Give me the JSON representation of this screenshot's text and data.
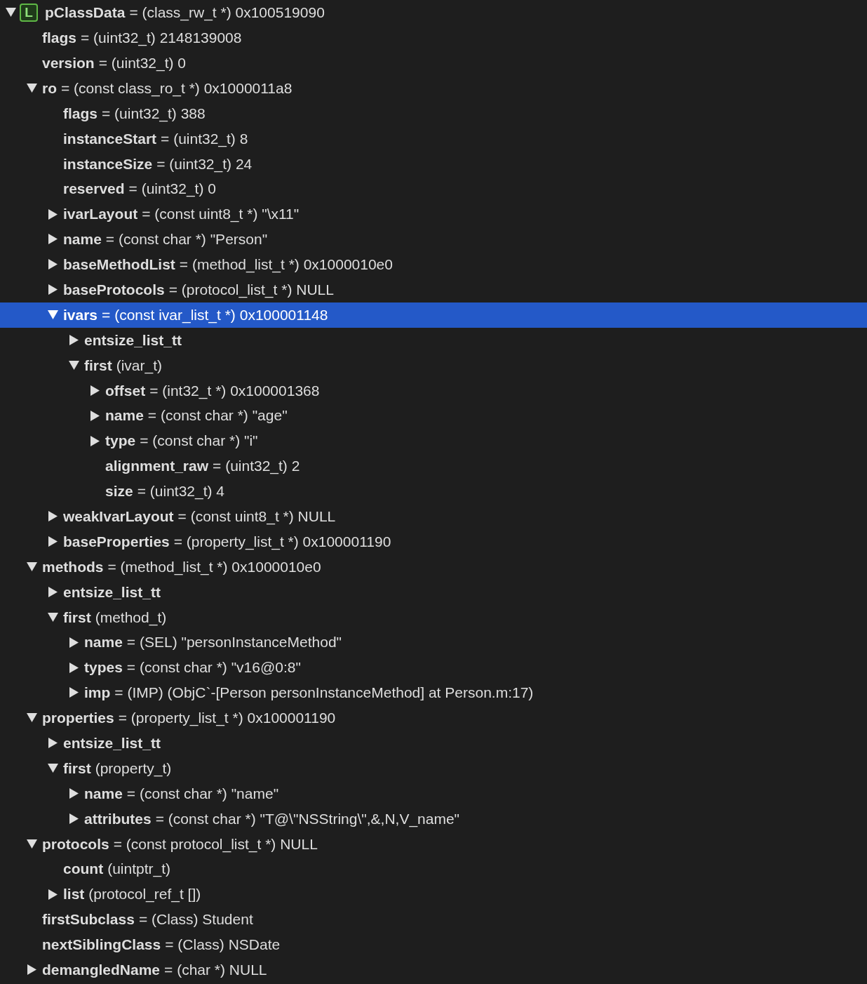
{
  "tree": [
    {
      "kind": "collapsible",
      "expanded": true,
      "selected": false,
      "badge": "L",
      "name": "pClassData",
      "value": "= (class_rw_t *) 0x100519090",
      "children": [
        {
          "kind": "plain",
          "selected": false,
          "name": "flags",
          "value": "= (uint32_t) 2148139008"
        },
        {
          "kind": "plain",
          "selected": false,
          "name": "version",
          "value": "= (uint32_t) 0"
        },
        {
          "kind": "collapsible",
          "expanded": true,
          "selected": false,
          "name": "ro",
          "value": "= (const class_ro_t *) 0x1000011a8",
          "children": [
            {
              "kind": "plain",
              "selected": false,
              "name": "flags",
              "value": "= (uint32_t) 388"
            },
            {
              "kind": "plain",
              "selected": false,
              "name": "instanceStart",
              "value": "= (uint32_t) 8"
            },
            {
              "kind": "plain",
              "selected": false,
              "name": "instanceSize",
              "value": "= (uint32_t) 24"
            },
            {
              "kind": "plain",
              "selected": false,
              "name": "reserved",
              "value": "= (uint32_t) 0"
            },
            {
              "kind": "collapsible",
              "expanded": false,
              "selected": false,
              "name": "ivarLayout",
              "value": "= (const uint8_t *) \"\\x11\""
            },
            {
              "kind": "collapsible",
              "expanded": false,
              "selected": false,
              "name": "name",
              "value": "= (const char *) \"Person\""
            },
            {
              "kind": "collapsible",
              "expanded": false,
              "selected": false,
              "name": "baseMethodList",
              "value": "= (method_list_t *) 0x1000010e0"
            },
            {
              "kind": "collapsible",
              "expanded": false,
              "selected": false,
              "name": "baseProtocols",
              "value": "= (protocol_list_t *) NULL"
            },
            {
              "kind": "collapsible",
              "expanded": true,
              "selected": true,
              "name": "ivars",
              "value": "= (const ivar_list_t *) 0x100001148",
              "children": [
                {
                  "kind": "collapsible",
                  "expanded": false,
                  "selected": false,
                  "name": "entsize_list_tt"
                },
                {
                  "kind": "collapsible",
                  "expanded": true,
                  "selected": false,
                  "name": "first",
                  "value": "(ivar_t)",
                  "children": [
                    {
                      "kind": "collapsible",
                      "expanded": false,
                      "selected": false,
                      "name": "offset",
                      "value": "= (int32_t *) 0x100001368"
                    },
                    {
                      "kind": "collapsible",
                      "expanded": false,
                      "selected": false,
                      "name": "name",
                      "value": "= (const char *) \"age\""
                    },
                    {
                      "kind": "collapsible",
                      "expanded": false,
                      "selected": false,
                      "name": "type",
                      "value": "= (const char *) \"i\""
                    },
                    {
                      "kind": "plain",
                      "selected": false,
                      "name": "alignment_raw",
                      "value": "= (uint32_t) 2"
                    },
                    {
                      "kind": "plain",
                      "selected": false,
                      "name": "size",
                      "value": "= (uint32_t) 4"
                    }
                  ]
                }
              ]
            },
            {
              "kind": "collapsible",
              "expanded": false,
              "selected": false,
              "name": "weakIvarLayout",
              "value": "= (const uint8_t *) NULL"
            },
            {
              "kind": "collapsible",
              "expanded": false,
              "selected": false,
              "name": "baseProperties",
              "value": "= (property_list_t *) 0x100001190"
            }
          ]
        },
        {
          "kind": "collapsible",
          "expanded": true,
          "selected": false,
          "name": "methods",
          "value": "= (method_list_t *) 0x1000010e0",
          "children": [
            {
              "kind": "collapsible",
              "expanded": false,
              "selected": false,
              "name": "entsize_list_tt"
            },
            {
              "kind": "collapsible",
              "expanded": true,
              "selected": false,
              "name": "first",
              "value": "(method_t)",
              "children": [
                {
                  "kind": "collapsible",
                  "expanded": false,
                  "selected": false,
                  "name": "name",
                  "value": "= (SEL) \"personInstanceMethod\""
                },
                {
                  "kind": "collapsible",
                  "expanded": false,
                  "selected": false,
                  "name": "types",
                  "value": "= (const char *) \"v16@0:8\""
                },
                {
                  "kind": "collapsible",
                  "expanded": false,
                  "selected": false,
                  "name": "imp",
                  "value": "= (IMP) (ObjC`-[Person personInstanceMethod] at Person.m:17)"
                }
              ]
            }
          ]
        },
        {
          "kind": "collapsible",
          "expanded": true,
          "selected": false,
          "name": "properties",
          "value": "= (property_list_t *) 0x100001190",
          "children": [
            {
              "kind": "collapsible",
              "expanded": false,
              "selected": false,
              "name": "entsize_list_tt"
            },
            {
              "kind": "collapsible",
              "expanded": true,
              "selected": false,
              "name": "first",
              "value": "(property_t)",
              "children": [
                {
                  "kind": "collapsible",
                  "expanded": false,
                  "selected": false,
                  "name": "name",
                  "value": "= (const char *) \"name\""
                },
                {
                  "kind": "collapsible",
                  "expanded": false,
                  "selected": false,
                  "name": "attributes",
                  "value": "= (const char *) \"T@\\\"NSString\\\",&,N,V_name\""
                }
              ]
            }
          ]
        },
        {
          "kind": "collapsible",
          "expanded": true,
          "selected": false,
          "name": "protocols",
          "value": "= (const protocol_list_t *) NULL",
          "children": [
            {
              "kind": "plain",
              "selected": false,
              "name": "count",
              "value": "(uintptr_t)"
            },
            {
              "kind": "collapsible",
              "expanded": false,
              "selected": false,
              "name": "list",
              "value": "(protocol_ref_t [])"
            }
          ]
        },
        {
          "kind": "plain",
          "selected": false,
          "name": "firstSubclass",
          "value": "= (Class) Student"
        },
        {
          "kind": "plain",
          "selected": false,
          "name": "nextSiblingClass",
          "value": "= (Class) NSDate"
        },
        {
          "kind": "collapsible",
          "expanded": false,
          "selected": false,
          "name": "demangledName",
          "value": "= (char *) NULL"
        }
      ]
    }
  ]
}
